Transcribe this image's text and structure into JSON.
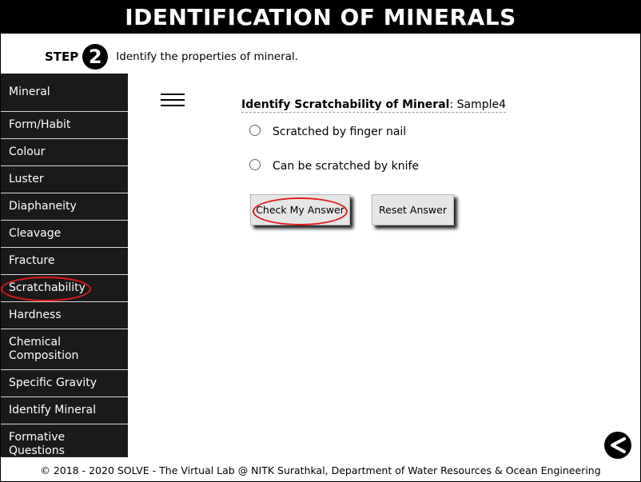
{
  "title": "IDENTIFICATION OF MINERALS",
  "step": {
    "label": "STEP",
    "number": "2",
    "instruction": "Identify the properties of mineral."
  },
  "sidebar": {
    "items": [
      {
        "label": "Mineral"
      },
      {
        "label": "Form/Habit"
      },
      {
        "label": "Colour"
      },
      {
        "label": "Luster"
      },
      {
        "label": "Diaphaneity"
      },
      {
        "label": "Cleavage"
      },
      {
        "label": "Fracture"
      },
      {
        "label": "Scratchability"
      },
      {
        "label": "Hardness"
      },
      {
        "label": "Chemical Composition"
      },
      {
        "label": "Specific Gravity"
      },
      {
        "label": "Identify Mineral"
      },
      {
        "label": "Formative Questions"
      }
    ],
    "selected": "Scratchability"
  },
  "question": {
    "prefix": "Identify Scratchability of Mineral",
    "separator": ":",
    "sample": " Sample4"
  },
  "options": [
    {
      "label": "Scratched by finger nail"
    },
    {
      "label": "Can be scratched by knife"
    }
  ],
  "buttons": {
    "check": "Check My Answer",
    "reset": "Reset Answer"
  },
  "footer": "© 2018 - 2020 SOLVE - The Virtual Lab @ NITK Surathkal, Department of Water Resources & Ocean Engineering",
  "colors": {
    "title_bg": "#000000",
    "sidebar_bg": "#1a1a1a",
    "highlight": "#e01b1b",
    "button_bg": "#e6e6e6"
  },
  "icons": {
    "menu": "hamburger-menu-icon",
    "back": "back-arrow-icon"
  }
}
